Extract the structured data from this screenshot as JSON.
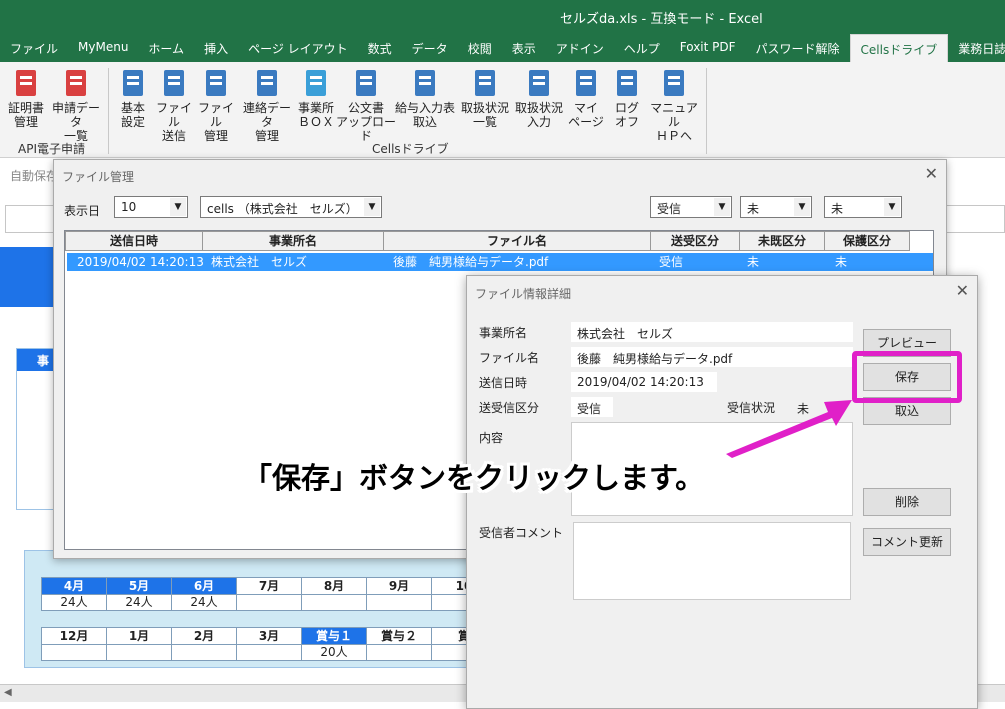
{
  "window": {
    "title": "セルズda.xls - 互換モード - Excel"
  },
  "tabs": [
    "ファイル",
    "MyMenu",
    "ホーム",
    "挿入",
    "ページ レイアウト",
    "数式",
    "データ",
    "校閲",
    "表示",
    "アドイン",
    "ヘルプ",
    "Foxit PDF",
    "パスワード解除",
    "Cellsドライブ",
    "業務日誌"
  ],
  "active_tab": "Cellsドライブ",
  "ribbon": {
    "group1": {
      "label": "API電子申請",
      "buttons": [
        {
          "line1": "証明書",
          "line2": "管理",
          "icon": "certificate-icon"
        },
        {
          "line1": "申請データ",
          "line2": "一覧",
          "icon": "egov-list-icon"
        }
      ]
    },
    "group2": {
      "label": "Cellsドライブ",
      "buttons": [
        {
          "line1": "基本",
          "line2": "設定",
          "icon": "gear-icon"
        },
        {
          "line1": "ファイル",
          "line2": "送信",
          "icon": "send-plane-icon"
        },
        {
          "line1": "ファイル",
          "line2": "管理",
          "icon": "document-icon"
        },
        {
          "line1": "連絡データ",
          "line2": "管理",
          "icon": "contact-icon"
        },
        {
          "line1": "事業所",
          "line2": "ＢＯＸ",
          "icon": "box-icon"
        },
        {
          "line1": "公文書",
          "line2": "アップロード",
          "icon": "upload-icon"
        },
        {
          "line1": "給与入力表",
          "line2": "取込",
          "icon": "yen-import-icon"
        },
        {
          "line1": "取扱状況",
          "line2": "一覧",
          "icon": "status-list-icon"
        },
        {
          "line1": "取扱状況",
          "line2": "入力",
          "icon": "status-input-icon"
        },
        {
          "line1": "マイ",
          "line2": "ページ",
          "icon": "home-icon"
        },
        {
          "line1": "ログ",
          "line2": "オフ",
          "icon": "key-icon"
        },
        {
          "line1": "マニュアル",
          "line2": "ＨＰへ",
          "icon": "help-icon"
        }
      ]
    }
  },
  "sheet": {
    "autosave_label": "自動保存",
    "left_panel_header": "事"
  },
  "months_row1": [
    {
      "label": "4月",
      "value": "24人",
      "hl": true
    },
    {
      "label": "5月",
      "value": "24人",
      "hl": true
    },
    {
      "label": "6月",
      "value": "24人",
      "hl": true
    },
    {
      "label": "7月",
      "value": ""
    },
    {
      "label": "8月",
      "value": ""
    },
    {
      "label": "9月",
      "value": ""
    },
    {
      "label": "10",
      "value": ""
    }
  ],
  "months_row2": [
    {
      "label": "12月",
      "value": ""
    },
    {
      "label": "1月",
      "value": ""
    },
    {
      "label": "2月",
      "value": ""
    },
    {
      "label": "3月",
      "value": ""
    },
    {
      "label": "賞与１",
      "value": "20人",
      "hl": true
    },
    {
      "label": "賞与２",
      "value": ""
    },
    {
      "label": "賞",
      "value": ""
    }
  ],
  "file_manager": {
    "title": "ファイル管理",
    "display_day_label": "表示日",
    "display_day_value": "10",
    "office_select": "cells （株式会社　セルズ）",
    "filter_direction": "受信",
    "filter_read": "未",
    "filter_saved": "未",
    "columns": [
      "送信日時",
      "事業所名",
      "ファイル名",
      "送受区分",
      "未既区分",
      "保護区分"
    ],
    "rows": [
      {
        "datetime": "2019/04/02 14:20:13",
        "office": "株式会社　セルズ",
        "file": "後藤　純男様給与データ.pdf",
        "direction": "受信",
        "read": "未",
        "saved": "未"
      }
    ]
  },
  "detail": {
    "title": "ファイル情報詳細",
    "office_label": "事業所名",
    "office_value": "株式会社　セルズ",
    "file_label": "ファイル名",
    "file_value": "後藤　純男様給与データ.pdf",
    "sent_label": "送信日時",
    "sent_value": "2019/04/02 14:20:13",
    "dir_label": "送受信区分",
    "dir_value": "受信",
    "status_label": "受信状況",
    "status_value": "未",
    "content_label": "内容",
    "comment_label": "受信者コメント",
    "buttons": {
      "preview": "プレビュー",
      "save": "保存",
      "import": "取込",
      "delete": "削除",
      "update_comment": "コメント更新"
    }
  },
  "annotation": {
    "caption": "「保存」ボタンをクリックします。",
    "highlight_color": "#e020c8"
  }
}
